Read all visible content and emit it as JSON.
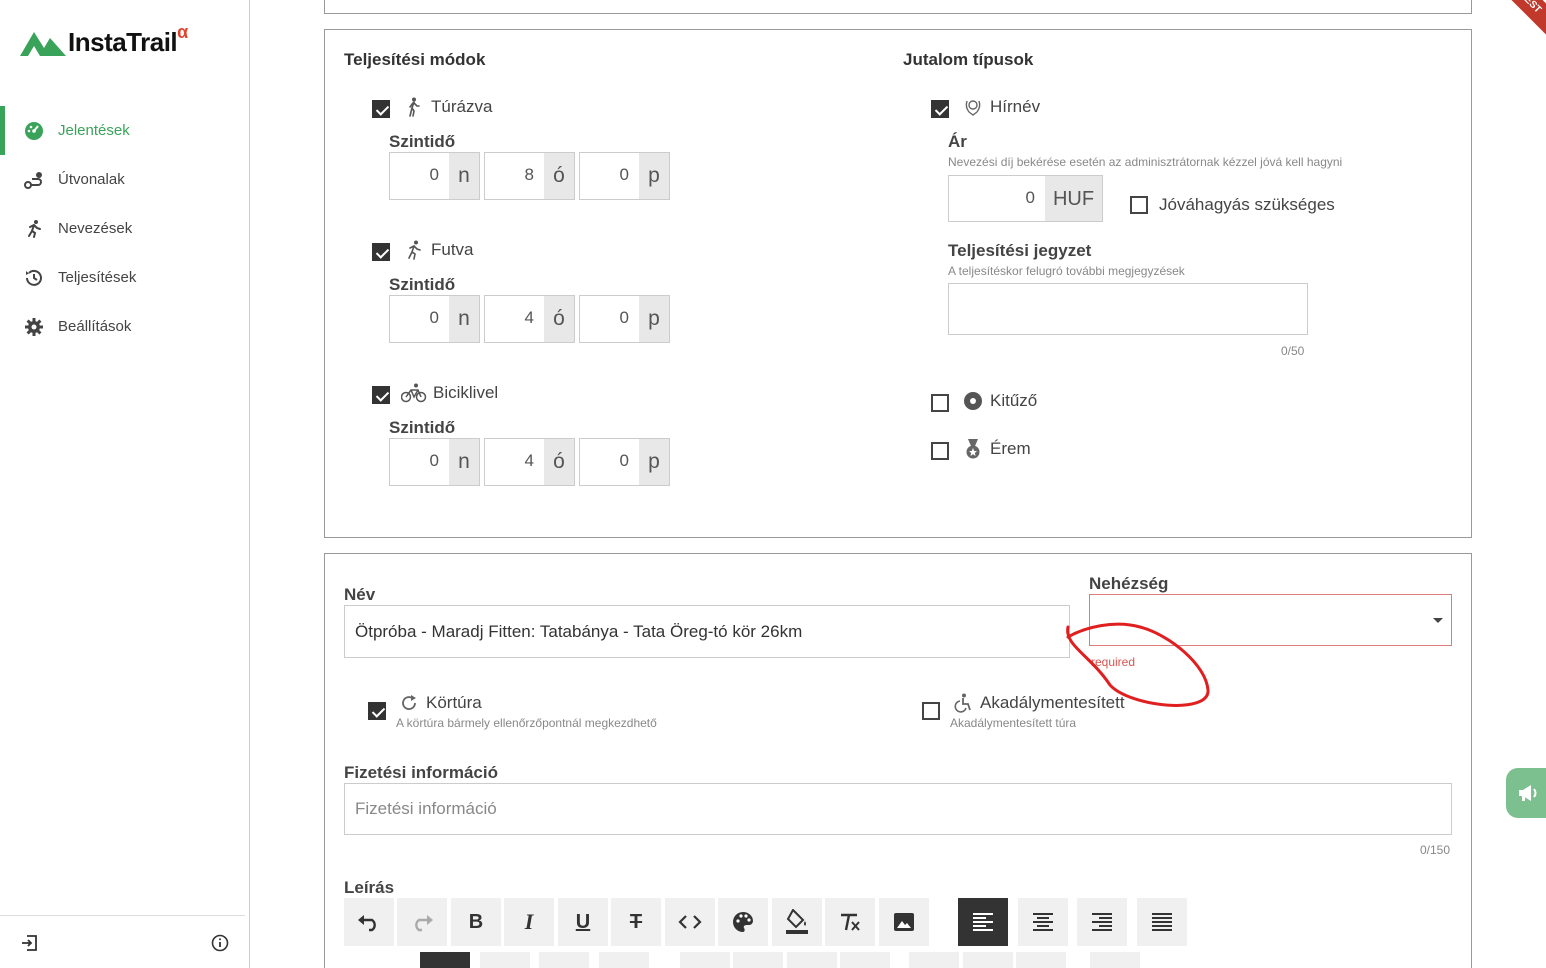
{
  "app": {
    "logo_text": "InstaTrail",
    "logo_suffix": "α",
    "ribbon": "TEST",
    "brand_color": "#3aa35a",
    "error_color": "#d9534f"
  },
  "sidebar": {
    "items": [
      {
        "label": "Jelentések",
        "icon": "dashboard-icon",
        "active": true
      },
      {
        "label": "Útvonalak",
        "icon": "route-icon",
        "active": false
      },
      {
        "label": "Nevezések",
        "icon": "runner-icon",
        "active": false
      },
      {
        "label": "Teljesítések",
        "icon": "history-icon",
        "active": false
      },
      {
        "label": "Beállítások",
        "icon": "gear-icon",
        "active": false
      }
    ]
  },
  "modes": {
    "title": "Teljesítési módok",
    "items": [
      {
        "label": "Túrázva",
        "icon": "hiker-icon",
        "checked": true,
        "level_label": "Szintidő",
        "n": "0",
        "o": "8",
        "p": "0"
      },
      {
        "label": "Futva",
        "icon": "runner-icon",
        "checked": true,
        "level_label": "Szintidő",
        "n": "0",
        "o": "4",
        "p": "0"
      },
      {
        "label": "Biciklivel",
        "icon": "bicycle-icon",
        "checked": true,
        "level_label": "Szintidő",
        "n": "0",
        "o": "4",
        "p": "0"
      }
    ],
    "unit_n": "n",
    "unit_o": "ó",
    "unit_p": "p"
  },
  "rewards": {
    "title": "Jutalom típusok",
    "fame": {
      "label": "Hírnév",
      "checked": true
    },
    "price": {
      "label": "Ár",
      "hint": "Nevezési díj bekérése esetén az adminisztrátornak kézzel jóvá kell hagyni",
      "value": "0",
      "currency": "HUF"
    },
    "approval": {
      "label": "Jóváhagyás szükséges",
      "checked": false
    },
    "note": {
      "label": "Teljesítési jegyzet",
      "hint": "A teljesítéskor felugró további megjegyzések",
      "value": "",
      "counter": "0/50"
    },
    "badge": {
      "label": "Kitűző",
      "checked": false
    },
    "medal": {
      "label": "Érem",
      "checked": false
    }
  },
  "details": {
    "name_label": "Név",
    "name_value": "Ötpróba - Maradj Fitten: Tatabánya - Tata Öreg-tó kör 26km",
    "difficulty_label": "Nehézség",
    "difficulty_value": "",
    "difficulty_error": "required",
    "loop": {
      "label": "Körtúra",
      "hint": "A körtúra bármely ellenőrzőpontnál megkezdhető",
      "checked": true
    },
    "accessible": {
      "label": "Akadálymentesített",
      "hint": "Akadálymentesített túra",
      "checked": false
    },
    "payment_label": "Fizetési információ",
    "payment_placeholder": "Fizetési információ",
    "payment_counter": "0/150",
    "description_label": "Leírás"
  }
}
